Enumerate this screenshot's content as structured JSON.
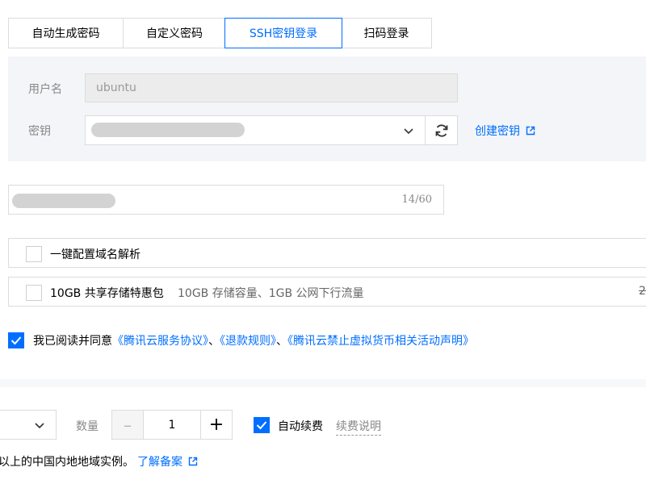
{
  "tabs": [
    {
      "label": "自动生成密码",
      "active": false
    },
    {
      "label": "自定义密码",
      "active": false
    },
    {
      "label": "SSH密钥登录",
      "active": true
    },
    {
      "label": "扫码登录",
      "active": false
    }
  ],
  "login": {
    "username_label": "用户名",
    "username_value": "ubuntu",
    "key_label": "密钥",
    "create_key_link": "创建密钥"
  },
  "instance_name": {
    "counter": "14/60"
  },
  "options": {
    "dns_label": "一键配置域名解析",
    "storage_label": "10GB 共享存储特惠包",
    "storage_desc": "10GB 存储容量、1GB 公网下行流量",
    "storage_price_partial": "2"
  },
  "agreement": {
    "prefix": "我已阅读并同意",
    "link1": "《腾讯云服务协议》",
    "sep1": "、",
    "link2": "《退款规则》",
    "sep2": "、",
    "link3": "《腾讯云禁止虚拟货币相关活动声明》"
  },
  "purchase": {
    "quantity_label": "数量",
    "quantity_value": "1",
    "decrement_symbol": "–",
    "increment_symbol": "+",
    "auto_renew_label": "自动续费",
    "renew_info_label": "续费说明"
  },
  "footer": {
    "note": "以上的中国内地地域实例。",
    "filing_link": "了解备案"
  },
  "colors": {
    "accent": "#006eff",
    "panel_bg": "#f3f5f8",
    "border": "#dcdcdc"
  },
  "icons": {
    "key_dropdown": "chevron-down-icon",
    "refresh": "refresh-icon",
    "external": "external-link-icon",
    "check": "check-icon"
  }
}
